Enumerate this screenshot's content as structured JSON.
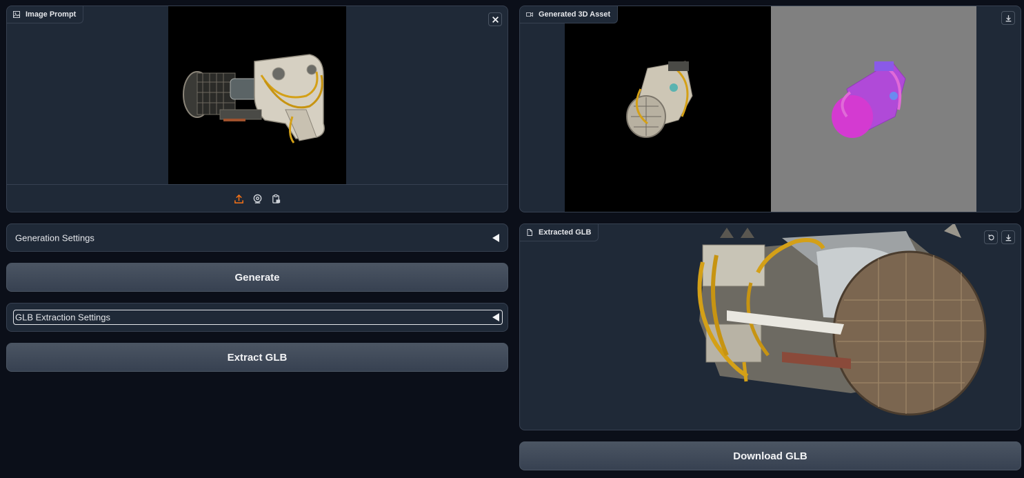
{
  "left": {
    "image_prompt": {
      "label": "Image Prompt",
      "label_icon": "image-icon",
      "close_icon": "close-icon",
      "source_icons": [
        "upload-icon",
        "webcam-icon",
        "clipboard-icon"
      ]
    },
    "generation_settings": {
      "label": "Generation Settings"
    },
    "generate_button": {
      "label": "Generate"
    },
    "glb_extraction_settings": {
      "label": "GLB Extraction Settings"
    },
    "extract_button": {
      "label": "Extract GLB"
    }
  },
  "right": {
    "generated_asset": {
      "label": "Generated 3D Asset",
      "label_icon": "video-icon",
      "download_icon": "download-icon"
    },
    "extracted_glb": {
      "label": "Extracted GLB",
      "label_icon": "file-icon",
      "reset_icon": "reset-icon",
      "download_icon": "download-icon"
    },
    "download_button": {
      "label": "Download GLB"
    }
  },
  "colors": {
    "background": "#0b0f19",
    "panel": "#1f2937",
    "border": "#374151",
    "accent": "#f97316",
    "mesh_background": "#808080"
  }
}
